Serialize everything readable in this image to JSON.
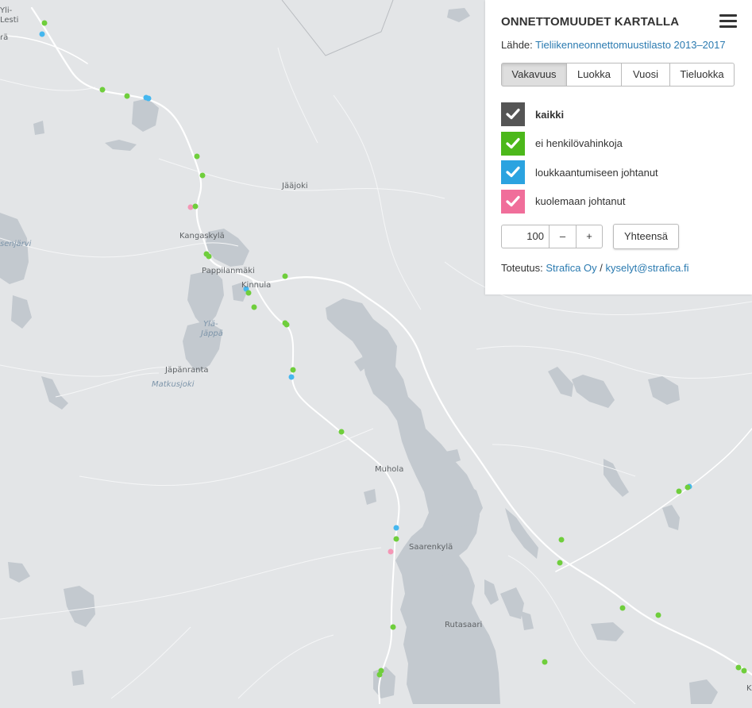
{
  "panel": {
    "title": "ONNETTOMUUDET KARTALLA",
    "menu_icon": "hamburger-menu-icon",
    "source_prefix": "Lähde: ",
    "source_link": "Tieliikenneonnettomuustilasto 2013–2017",
    "tabs": [
      {
        "label": "Vakavuus",
        "active": true
      },
      {
        "label": "Luokka",
        "active": false
      },
      {
        "label": "Vuosi",
        "active": false
      },
      {
        "label": "Tieluokka",
        "active": false
      }
    ],
    "legend": [
      {
        "label": "kaikki",
        "color": "#555555",
        "checked": true
      },
      {
        "label": "ei henkilövahinkoja",
        "color": "#4cb81b",
        "checked": true
      },
      {
        "label": "loukkaantumiseen johtanut",
        "color": "#2ba3e0",
        "checked": true
      },
      {
        "label": "kuolemaan johtanut",
        "color": "#f06e9a",
        "checked": true
      }
    ],
    "limit_value": "100",
    "minus_label": "–",
    "plus_label": "+",
    "total_button": "Yhteensä",
    "credits_prefix": "Toteutus: ",
    "credits_company": "Strafica Oy",
    "credits_separator": " / ",
    "credits_email": "kyselyt@strafica.fi"
  },
  "map": {
    "places": [
      "Yli-",
      "Lesti",
      "rä",
      "Jääjoki",
      "Kangaskylä",
      "Pappilanmäki",
      "Kinnula",
      "Ylä-",
      "Jäppä",
      "Jäpänranta",
      "Matkusjoki",
      "senjärvi",
      "Muhola",
      "Saarenkylä",
      "Rutasaari",
      "K"
    ],
    "colors": {
      "land": "#e3e5e7",
      "water": "#c3c9cf",
      "road": "#ffffff"
    }
  }
}
